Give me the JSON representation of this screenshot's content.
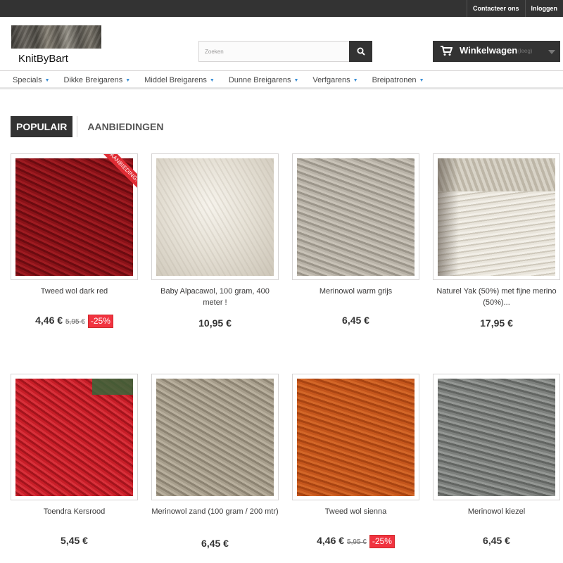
{
  "topbar": {
    "contact": "Contacteer ons",
    "login": "Inloggen"
  },
  "header": {
    "logo_text": "KnitByBart",
    "search_placeholder": "Zoeken",
    "cart_label": "Winkelwagen",
    "cart_status": "(leeg)"
  },
  "menu": [
    "Specials",
    "Dikke Breigarens",
    "Middel Breigarens",
    "Dunne Breigarens",
    "Verfgarens",
    "Breipatronen"
  ],
  "tabs": {
    "active": "POPULAIR",
    "inactive": "AANBIEDINGEN"
  },
  "ribbon_label": "Aanbieding!",
  "products": [
    {
      "name": "Tweed wol dark red",
      "price": "4,46 €",
      "old_price": "5,95 €",
      "discount": "-25%",
      "color": "#7a1015"
    },
    {
      "name": "Baby Alpacawol, 100 gram, 400 meter !",
      "price": "10,95 €",
      "color": "#e6e1d6"
    },
    {
      "name": "Merinowol warm grijs",
      "price": "6,45 €",
      "color": "#b0aa9f"
    },
    {
      "name": "Naturel Yak (50%) met fijne merino (50%)...",
      "price": "17,95 €",
      "color": "#e6e2d8"
    },
    {
      "name": "Toendra Kersrood",
      "price": "5,45 €",
      "color": "#c81e28"
    },
    {
      "name": "Merinowol zand (100 gram / 200 mtr)",
      "price": "6,45 €",
      "color": "#a79e8c"
    },
    {
      "name": "Tweed wol sienna",
      "price": "4,46 €",
      "old_price": "5,95 €",
      "discount": "-25%",
      "color": "#c5561c"
    },
    {
      "name": "Merinowol kiezel",
      "price": "6,45 €",
      "color": "#7d807d"
    }
  ]
}
